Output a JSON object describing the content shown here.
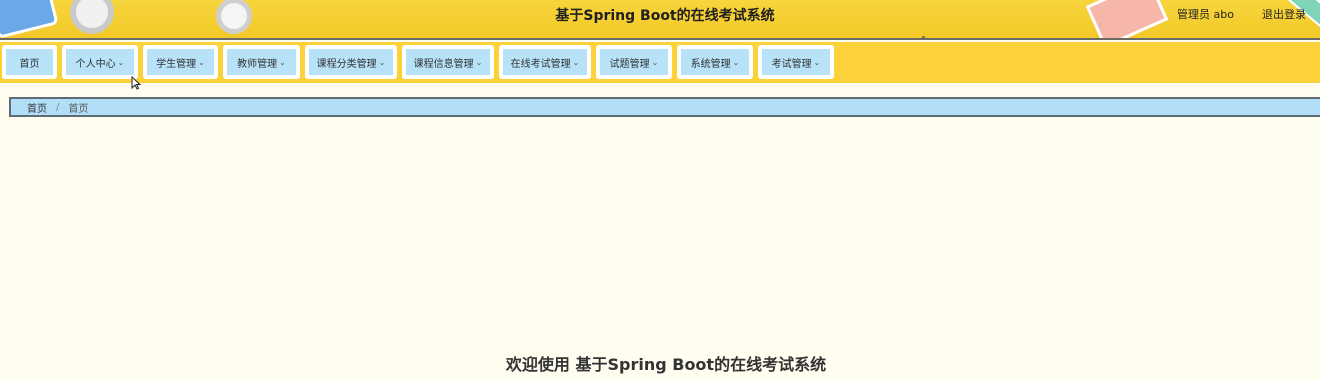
{
  "header": {
    "title": "基于Spring Boot的在线考试系统",
    "user_label": "管理员 abo",
    "logout_label": "退出登录"
  },
  "nav": {
    "items": [
      {
        "label": "首页",
        "has_dropdown": false
      },
      {
        "label": "个人中心",
        "has_dropdown": true
      },
      {
        "label": "学生管理",
        "has_dropdown": true
      },
      {
        "label": "教师管理",
        "has_dropdown": true
      },
      {
        "label": "课程分类管理",
        "has_dropdown": true
      },
      {
        "label": "课程信息管理",
        "has_dropdown": true
      },
      {
        "label": "在线考试管理",
        "has_dropdown": true
      },
      {
        "label": "试题管理",
        "has_dropdown": true
      },
      {
        "label": "系统管理",
        "has_dropdown": true
      },
      {
        "label": "考试管理",
        "has_dropdown": true
      }
    ],
    "caret": "⌄"
  },
  "breadcrumb": {
    "items": [
      "首页",
      "首页"
    ],
    "separator": "/"
  },
  "main": {
    "welcome": "欢迎使用 基于Spring Boot的在线考试系统"
  },
  "colors": {
    "header_bg": "#f7d53d",
    "nav_bg": "#fcd23b",
    "nav_item_bg": "#b7e2f8",
    "breadcrumb_bg": "#b2def8",
    "page_bg": "#fffcf0"
  }
}
